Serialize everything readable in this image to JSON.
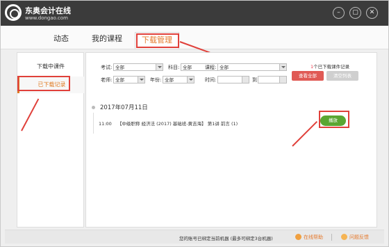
{
  "app": {
    "brand_cn": "东奥会计在线",
    "brand_url": "www.dongao.com",
    "window_controls": [
      "minimize-icon",
      "maximize-icon",
      "close-icon"
    ]
  },
  "nav": {
    "tabs": [
      {
        "label": "动态"
      },
      {
        "label": "我的课程"
      },
      {
        "label": "下载管理"
      }
    ],
    "active_tab": "下载管理"
  },
  "sidebar": {
    "items": [
      {
        "label": "下载中课件"
      },
      {
        "label": "已下载记录"
      }
    ],
    "active": "已下载记录"
  },
  "filters": {
    "exam_label": "考试:",
    "exam_value": "全部",
    "subject_label": "科目:",
    "subject_value": "全部",
    "course_label": "课程:",
    "course_value": "全部",
    "teacher_label": "老师:",
    "teacher_value": "全部",
    "year_label": "年份:",
    "year_value": "全部",
    "time_label": "时间:",
    "to_label": "到",
    "count_prefix": "",
    "count_num": "1",
    "count_suffix": "个已下载课件记录",
    "view_all_label": "查看全部",
    "clear_list_label": "清空列表"
  },
  "records": {
    "date": "2017年07月11日",
    "items": [
      {
        "time": "11:00",
        "title": "【中级职称 经济法 (2017) 基础班-黄吉海】 第1讲 前言 (1)",
        "action": "播放"
      }
    ]
  },
  "footer": {
    "notice": "您的账号已绑定当前机器 (最多可绑定3台机器)",
    "help_label": "在线帮助",
    "feedback_label": "问题反馈"
  },
  "colors": {
    "accent": "#e5782a",
    "annotation": "#e0403a",
    "play": "#5aa632",
    "titlebar": "#3b3b3b"
  }
}
